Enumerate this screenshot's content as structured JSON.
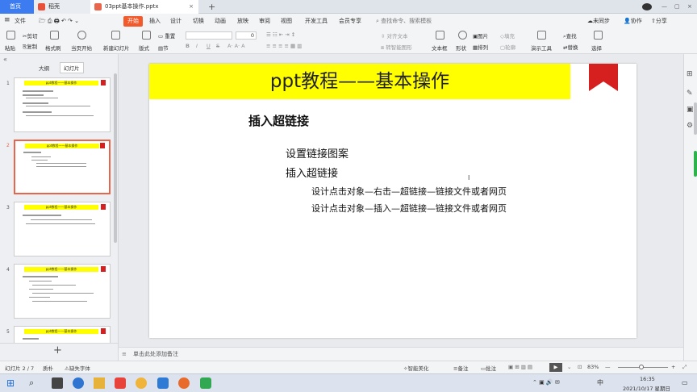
{
  "tabs": {
    "home": "首页",
    "daoke": "稻壳",
    "doc": "03ppt基本操作.pptx"
  },
  "menu": {
    "file": "文件",
    "items": [
      "开始",
      "插入",
      "设计",
      "切换",
      "动画",
      "放映",
      "审阅",
      "视图",
      "开发工具",
      "会员专享"
    ],
    "search": "查找命令、搜索模板",
    "sync": "未同步",
    "collab": "协作",
    "share": "分享"
  },
  "ribbon": {
    "paste": "粘贴",
    "cut": "剪切",
    "copy": "复制",
    "format_painter": "格式刷",
    "play_from_current": "当页开始",
    "new_slide": "新建幻灯片",
    "layout": "版式",
    "section": "节",
    "reset": "重置",
    "font_name": "",
    "font_size": "0",
    "bold": "B",
    "italic": "I",
    "underline": "U",
    "strike": "S",
    "align_text": "对齐文本",
    "smartart": "转智能图形",
    "textbox": "文本框",
    "shape": "形状",
    "arrange": "排列",
    "picture": "图片",
    "fill": "填充",
    "outline": "轮廓",
    "presenter": "演示工具",
    "find": "查找",
    "replace": "替换",
    "select": "选择"
  },
  "panel": {
    "outline_tab": "大纲",
    "slides_tab": "幻灯片",
    "thumb_title": "ppt教程——基本操作"
  },
  "thumbs": [
    {
      "num": "1"
    },
    {
      "num": "2"
    },
    {
      "num": "3"
    },
    {
      "num": "4"
    },
    {
      "num": "5"
    }
  ],
  "slide": {
    "title": "ppt教程——基本操作",
    "heading": "插入超链接",
    "line1": "设置链接图案",
    "line2": "插入超链接",
    "line3": "设计点击对象—右击—超链接—链接文件或者网页",
    "line4": "设计点击对象—插入—超链接—链接文件或者网页"
  },
  "notes": {
    "placeholder": "单击此处添加备注"
  },
  "status": {
    "slide_count": "幻灯片 2 / 7",
    "theme": "质朴",
    "missing_font": "缺失字体",
    "beautify": "智能美化",
    "notes": "备注",
    "comments": "批注",
    "zoom": "83%"
  },
  "taskbar": {
    "time": "16:35",
    "date": "2021/10/17 星期日",
    "ime": "中"
  },
  "colors": {
    "accent": "#f25a2b",
    "banner": "#ffff00",
    "flag": "#d62020",
    "tab_active": "#3c7cf0"
  }
}
